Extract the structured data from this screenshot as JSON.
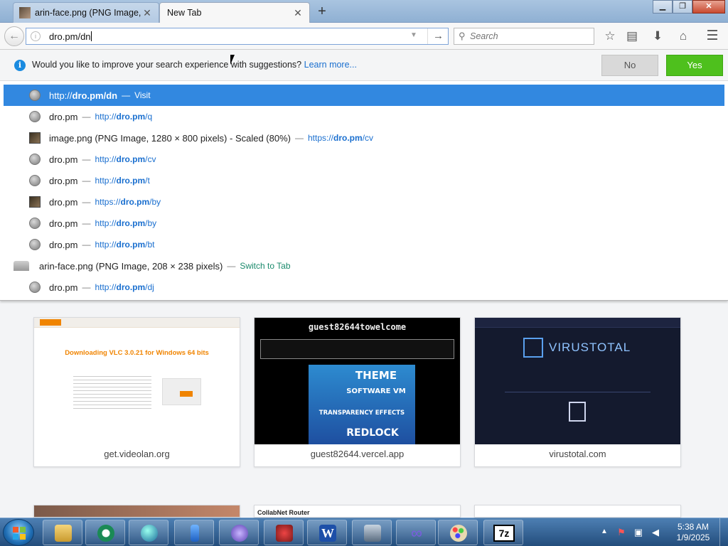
{
  "browser": {
    "tabs": [
      {
        "title": "arin-face.png (PNG Image, 208 × 238 pixels)",
        "close": "✕"
      },
      {
        "title": "New Tab",
        "close": "✕"
      }
    ],
    "new_tab_symbol": "+",
    "window_buttons": {
      "minimize": "▁",
      "restore": "❐",
      "close": "✕"
    },
    "url_value": "dro.pm/dn",
    "search_placeholder": "Search",
    "icons": [
      "back-arrow-icon",
      "info-icon",
      "dropdown-arrow-icon",
      "go-arrow-icon",
      "search-icon",
      "bookmark-star-icon",
      "bookmarks-list-icon",
      "download-icon",
      "home-icon",
      "menu-icon"
    ]
  },
  "suggest_prompt": {
    "text": "Would you like to improve your search experience with suggestions?",
    "learn_more": "Learn more...",
    "no": "No",
    "yes": "Yes"
  },
  "autocomplete": [
    {
      "title": "",
      "sep": "",
      "url_prefix": "http://",
      "url_bold": "dro.pm/dn",
      "url_suffix": "",
      "action": "Visit",
      "icon": "globe",
      "selected": true
    },
    {
      "title": "dro.pm",
      "sep": "—",
      "url_prefix": "http://",
      "url_bold": "dro.pm",
      "url_suffix": "/q",
      "action": "",
      "icon": "globe"
    },
    {
      "title": "image.png (PNG Image, 1280 × 800 pixels) - Scaled (80%)",
      "sep": "—",
      "url_prefix": "https://",
      "url_bold": "dro.pm",
      "url_suffix": "/cv",
      "action": "",
      "icon": "thumb"
    },
    {
      "title": "dro.pm",
      "sep": "—",
      "url_prefix": "http://",
      "url_bold": "dro.pm",
      "url_suffix": "/cv",
      "action": "",
      "icon": "globe"
    },
    {
      "title": "dro.pm",
      "sep": "—",
      "url_prefix": "http://",
      "url_bold": "dro.pm",
      "url_suffix": "/t",
      "action": "",
      "icon": "globe"
    },
    {
      "title": "dro.pm",
      "sep": "—",
      "url_prefix": "https://",
      "url_bold": "dro.pm",
      "url_suffix": "/by",
      "action": "",
      "icon": "thumb"
    },
    {
      "title": "dro.pm",
      "sep": "—",
      "url_prefix": "http://",
      "url_bold": "dro.pm",
      "url_suffix": "/by",
      "action": "",
      "icon": "globe"
    },
    {
      "title": "dro.pm",
      "sep": "—",
      "url_prefix": "http://",
      "url_bold": "dro.pm",
      "url_suffix": "/bt",
      "action": "",
      "icon": "globe"
    },
    {
      "title": "arin-face.png (PNG Image, 208 × 238 pixels)",
      "sep": "—",
      "url_prefix": "",
      "url_bold": "",
      "url_suffix": "",
      "action": "Switch to Tab",
      "icon": "tab"
    },
    {
      "title": "dro.pm",
      "sep": "—",
      "url_prefix": "http://",
      "url_bold": "dro.pm",
      "url_suffix": "/dj",
      "action": "",
      "icon": "globe"
    }
  ],
  "top_sites": [
    {
      "label": "get.videolan.org",
      "thumb_title": "Downloading VLC 3.0.21 for Windows 64 bits"
    },
    {
      "label": "guest82644.vercel.app",
      "thumb_title": "guest82644towelcome",
      "thumb_lines": [
        "THEME",
        "SOFTWARE VM",
        "TRANSPARENCY EFFECTS",
        "REDLOCK"
      ]
    },
    {
      "label": "virustotal.com",
      "thumb_title": "VIRUSTOTAL"
    }
  ],
  "partial_tile_text": "CollabNet Router",
  "taskbar": {
    "apps": [
      "file-explorer-icon",
      "steam-like-app-icon",
      "browser-globe-icon",
      "usb-drive-icon",
      "gear-app-icon",
      "spider-app-icon",
      "word-icon",
      "network-computer-icon",
      "infinity-app-icon",
      "paint-icon",
      "7zip-icon"
    ],
    "seven_zip_label": "7z",
    "tray_arrow": "▲",
    "time": "5:38 AM",
    "date": "1/9/2025"
  },
  "colors": {
    "selected_row": "#3288e0",
    "link": "#1a6fcf",
    "yes_button": "#4ec01d",
    "switch_to_tab": "#1a8a6c"
  }
}
